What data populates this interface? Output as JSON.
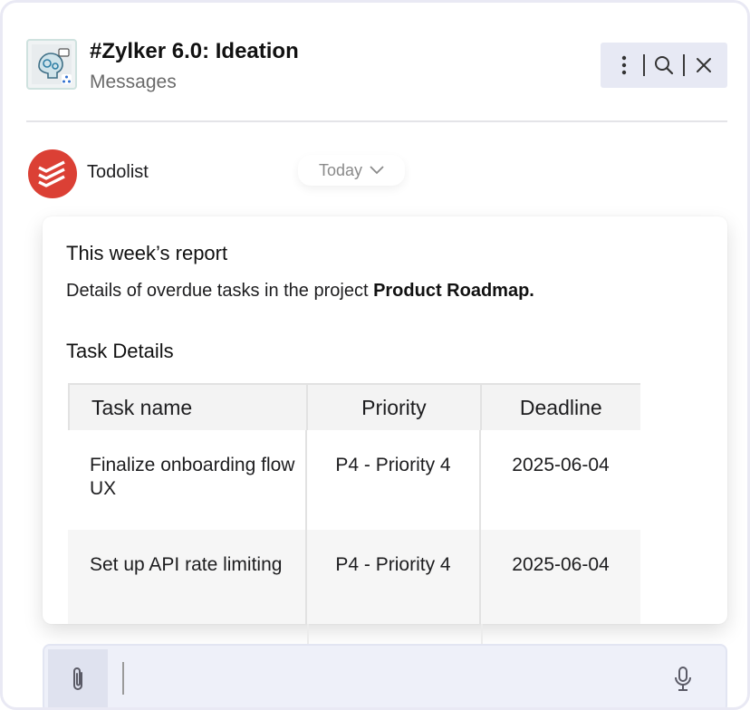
{
  "header": {
    "channel_title": "#Zylker 6.0: Ideation",
    "channel_subtitle": "Messages",
    "channel_icon": "brain-gears-icon",
    "actions": [
      {
        "icon": "more-vertical-icon"
      },
      {
        "icon": "search-icon"
      },
      {
        "icon": "close-icon"
      }
    ]
  },
  "message": {
    "sender": "Todolist",
    "sender_avatar_color": "#db4035",
    "date_label": "Today"
  },
  "card": {
    "title": "This week’s report",
    "description_prefix": "Details of overdue tasks in the project ",
    "project_name": "Product Roadmap.",
    "section_title": "Task Details",
    "table": {
      "headers": [
        "Task name",
        "Priority",
        "Deadline"
      ],
      "rows": [
        {
          "task": "Finalize onboarding flow UX",
          "priority": "P4 - Priority 4",
          "deadline": "2025-06-04"
        },
        {
          "task": "Set up API rate limiting",
          "priority": "P4 - Priority 4",
          "deadline": "2025-06-04"
        }
      ]
    }
  },
  "composer": {
    "placeholder": "",
    "attach_icon": "paperclip-icon",
    "mic_icon": "microphone-icon"
  }
}
